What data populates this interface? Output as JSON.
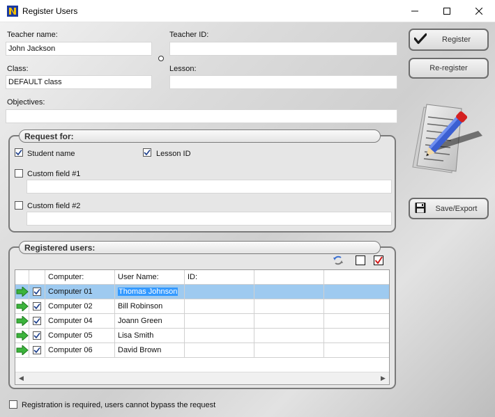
{
  "window": {
    "title": "Register Users"
  },
  "form": {
    "teacher_name_label": "Teacher name:",
    "teacher_name_value": "John Jackson",
    "teacher_id_label": "Teacher ID:",
    "teacher_id_value": "",
    "class_label": "Class:",
    "class_value": "DEFAULT class",
    "lesson_label": "Lesson:",
    "lesson_value": "",
    "objectives_label": "Objectives:",
    "objectives_value": ""
  },
  "buttons": {
    "register": "Register",
    "reregister": "Re-register",
    "save_export": "Save/Export"
  },
  "request_for": {
    "title": "Request for:",
    "student_name": {
      "label": "Student name",
      "checked": true
    },
    "lesson_id": {
      "label": "Lesson ID",
      "checked": true
    },
    "custom1": {
      "label": "Custom field #1",
      "checked": false,
      "value": ""
    },
    "custom2": {
      "label": "Custom field #2",
      "checked": false,
      "value": ""
    }
  },
  "registered": {
    "title": "Registered users:",
    "columns": [
      "Computer:",
      "User Name:",
      "ID:",
      "",
      ""
    ],
    "rows": [
      {
        "computer": "Computer 01",
        "user": "Thomas Johnson",
        "id": "",
        "checked": true,
        "selected": true
      },
      {
        "computer": "Computer 02",
        "user": "Bill Robinson",
        "id": "",
        "checked": true,
        "selected": false
      },
      {
        "computer": "Computer 04",
        "user": "Joann Green",
        "id": "",
        "checked": true,
        "selected": false
      },
      {
        "computer": "Computer 05",
        "user": "Lisa Smith",
        "id": "",
        "checked": true,
        "selected": false
      },
      {
        "computer": "Computer 06",
        "user": "David Brown",
        "id": "",
        "checked": true,
        "selected": false
      }
    ]
  },
  "footer": {
    "required_label": "Registration is required, users cannot bypass the request",
    "required_checked": false
  },
  "icons": {
    "app": "app-logo-icon",
    "register": "checkmark-icon",
    "save": "floppy-disk-icon",
    "refresh": "refresh-icon",
    "row_arrow": "green-arrow-icon",
    "illustration": "document-pencil-icon"
  }
}
